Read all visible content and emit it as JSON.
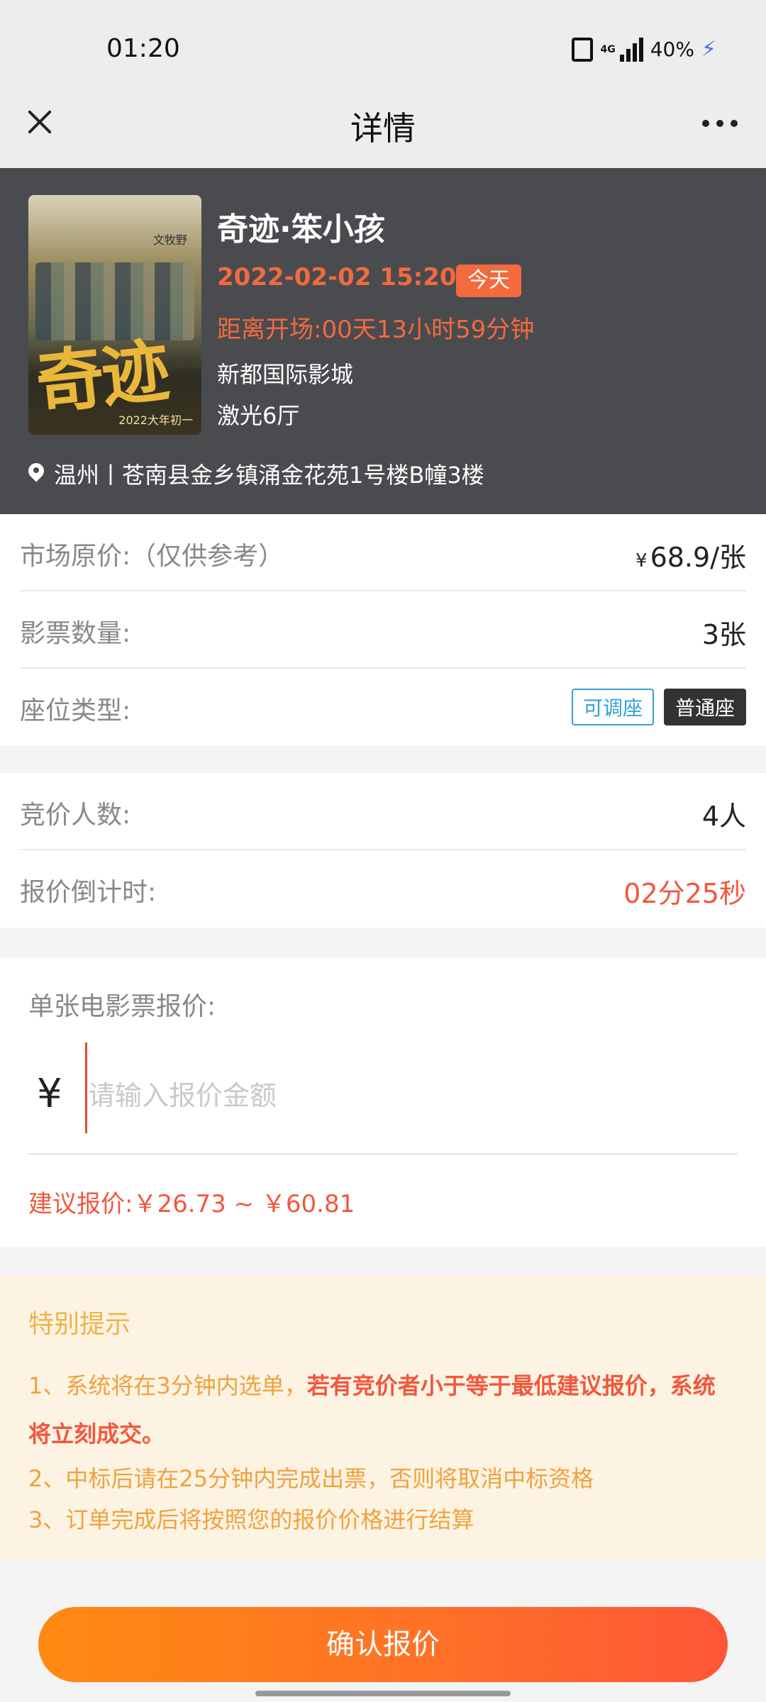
{
  "status_bar": {
    "time": "01:20",
    "net_label": "4G",
    "battery": "40%"
  },
  "nav": {
    "title": "详情"
  },
  "movie": {
    "title": "奇迹·笨小孩",
    "showtime": "2022-02-02 15:20",
    "today_badge": "今天",
    "countdown": "距离开场:00天13小时59分钟",
    "cinema": "新都国际影城",
    "hall": "激光6厅",
    "address": "温州丨苍南县金乡镇涌金花苑1号楼B幢3楼",
    "poster": {
      "title": "奇迹",
      "tag": "2022大年初一",
      "cast": "文牧野"
    }
  },
  "info": {
    "market_price_label": "市场原价:（仅供参考）",
    "market_price_currency": "¥",
    "market_price_value": "68.9/张",
    "ticket_count_label": "影票数量:",
    "ticket_count_value": "3张",
    "seat_type_label": "座位类型:",
    "seat_tags": [
      "可调座",
      "普通座"
    ]
  },
  "bidding": {
    "bidders_label": "竞价人数:",
    "bidders_value": "4人",
    "countdown_label": "报价倒计时:",
    "countdown_value": "02分25秒"
  },
  "bid_form": {
    "label": "单张电影票报价:",
    "currency": "¥",
    "placeholder": "请输入报价金额",
    "suggestion": "建议报价:￥26.73 ~ ￥60.81"
  },
  "tips": {
    "title": "特别提示",
    "tip1_prefix": "1、系统将在3分钟内选单，",
    "tip1_strong": "若有竞价者小于等于最低建议报价，系统将立刻成交。",
    "tip2": "2、中标后请在25分钟内完成出票，否则将取消中标资格",
    "tip3": "3、订单完成后将按照您的报价价格进行结算"
  },
  "actions": {
    "confirm_label": "确认报价"
  }
}
